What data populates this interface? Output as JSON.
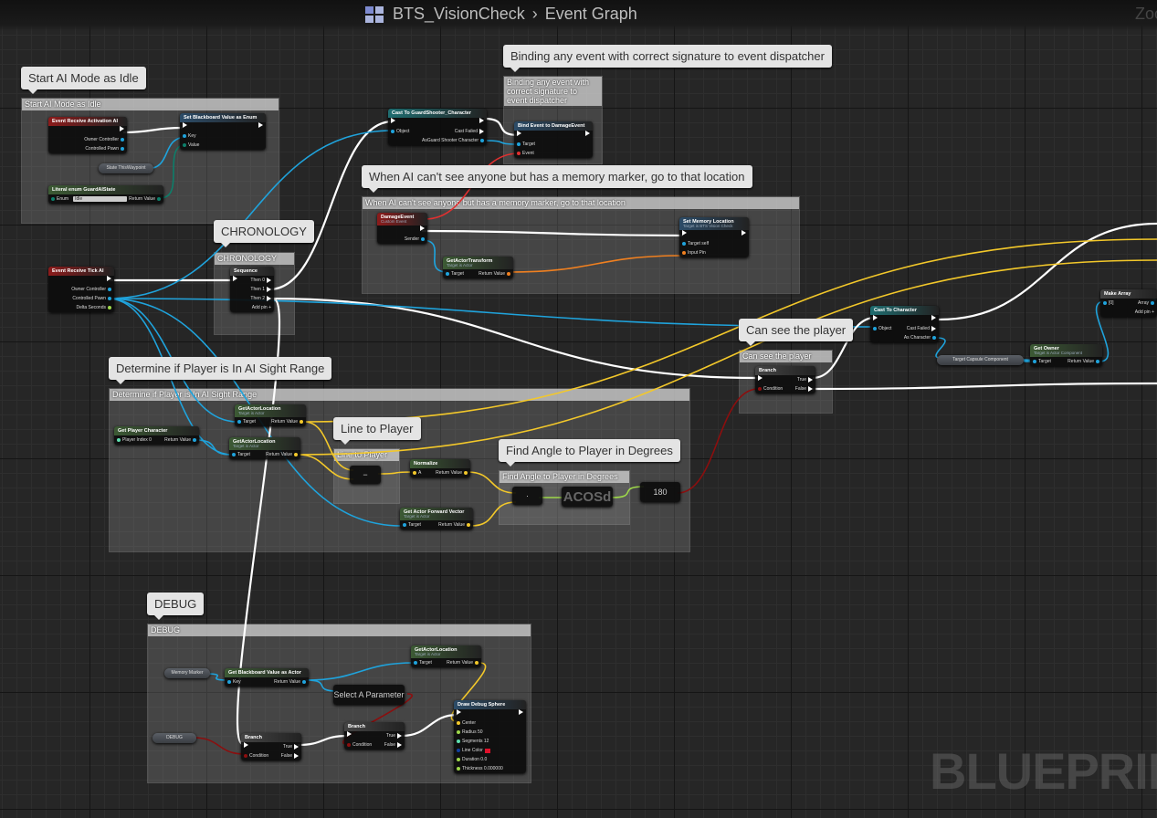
{
  "header": {
    "blueprint": "BTS_VisionCheck",
    "separator": "›",
    "graph": "Event Graph",
    "zoom_label": "Zoom"
  },
  "watermark": "BLUEPRINT",
  "pin_colors": {
    "exec": "#ffffff",
    "object": "#1fa3dc",
    "vector": "#f3c82a",
    "bool": "#8c0e0e",
    "float": "#9ed84a",
    "byte": "#0d7e6a",
    "int": "#5ee0b0",
    "struct": "#f08020",
    "delegate": "#e03030",
    "color": "#1040a0",
    "name": "#c870e0"
  },
  "header_colors": {
    "event": "#8c1b1b",
    "func": "#3c5a34",
    "cast": "#1f6d70",
    "call": "#2c4c68",
    "pure": "#444"
  },
  "comments": [
    {
      "id": "c_idle",
      "title": "Start AI Mode as Idle"
    },
    {
      "id": "c_bind",
      "title": "Binding any event with correct signature to event dispatcher"
    },
    {
      "id": "c_memory",
      "title": "When AI can't see anyone but has a memory marker, go to that location"
    },
    {
      "id": "c_chrono",
      "title": "CHRONOLOGY"
    },
    {
      "id": "c_see",
      "title": "Can see the player"
    },
    {
      "id": "c_sight",
      "title": "Determine if Player is In AI Sight Range"
    },
    {
      "id": "c_line",
      "title": "Line to Player"
    },
    {
      "id": "c_angle",
      "title": "Find Angle to Player in Degrees"
    },
    {
      "id": "c_debug",
      "title": "DEBUG"
    }
  ],
  "nodes": [
    {
      "id": "evt_activation",
      "kind": "event",
      "title": "Event Receive Activation AI",
      "in": [],
      "out": [
        {
          "t": "exec"
        },
        {
          "l": "Owner Controller",
          "t": "object"
        },
        {
          "l": "Controlled Pawn",
          "t": "object"
        }
      ]
    },
    {
      "id": "set_bb_enum",
      "kind": "call",
      "title": "Set Blackboard Value as Enum",
      "in": [
        {
          "t": "exec"
        },
        {
          "l": "Key",
          "t": "object"
        },
        {
          "l": "Value",
          "t": "byte"
        }
      ],
      "out": [
        {
          "t": "exec"
        }
      ]
    },
    {
      "id": "state_var",
      "kind": "var",
      "title": "State ThisWaypoint"
    },
    {
      "id": "literal_enum",
      "kind": "func",
      "title": "Literal enum GuardAIState",
      "in": [
        {
          "l": "Enum",
          "t": "byte",
          "sel": "Idle"
        }
      ],
      "out": [
        {
          "l": "Return Value",
          "t": "byte"
        }
      ]
    },
    {
      "id": "evt_tick",
      "kind": "event",
      "title": "Event Receive Tick AI",
      "in": [],
      "out": [
        {
          "t": "exec"
        },
        {
          "l": "Owner Controller",
          "t": "object"
        },
        {
          "l": "Controlled Pawn",
          "t": "object"
        },
        {
          "l": "Delta Seconds",
          "t": "float"
        }
      ]
    },
    {
      "id": "sequence",
      "kind": "pure",
      "title": "Sequence",
      "in": [
        {
          "t": "exec"
        }
      ],
      "out": [
        {
          "l": "Then 0",
          "t": "exec"
        },
        {
          "l": "Then 1",
          "t": "exec"
        },
        {
          "l": "Then 2",
          "t": "exec"
        },
        {
          "l": "Add pin +",
          "t": "none"
        }
      ]
    },
    {
      "id": "cast_guard",
      "kind": "cast",
      "title": "Cast To GuardShooter_Character",
      "in": [
        {
          "t": "exec"
        },
        {
          "l": "Object",
          "t": "object"
        }
      ],
      "out": [
        {
          "t": "exec"
        },
        {
          "l": "Cast Failed",
          "t": "exec"
        },
        {
          "l": "AsGuard Shooter Character",
          "t": "object"
        }
      ]
    },
    {
      "id": "bind_event",
      "kind": "call",
      "title": "Bind Event to DamageEvent",
      "in": [
        {
          "t": "exec"
        },
        {
          "l": "Target",
          "t": "object"
        },
        {
          "l": "Event",
          "t": "delegate"
        }
      ],
      "out": [
        {
          "t": "exec"
        }
      ]
    },
    {
      "id": "damage_event",
      "kind": "event",
      "title": "DamageEvent",
      "sub": "Custom Event",
      "in": [],
      "out": [
        {
          "t": "exec"
        },
        {
          "l": "Sender",
          "t": "object"
        }
      ]
    },
    {
      "id": "get_transform",
      "kind": "func",
      "title": "GetActorTransform",
      "sub": "Target is Actor",
      "in": [
        {
          "l": "Target",
          "t": "object"
        }
      ],
      "out": [
        {
          "l": "Return Value",
          "t": "struct"
        }
      ]
    },
    {
      "id": "set_memory",
      "kind": "call",
      "title": "Set Memory Location",
      "sub": "Target is BTS Vision Check",
      "in": [
        {
          "t": "exec"
        },
        {
          "l": "Target  self",
          "t": "object"
        },
        {
          "l": "Input Pin",
          "t": "struct"
        }
      ],
      "out": [
        {
          "t": "exec"
        }
      ]
    },
    {
      "id": "branch_see",
      "kind": "pure",
      "title": "Branch",
      "in": [
        {
          "t": "exec"
        },
        {
          "l": "Condition",
          "t": "bool"
        }
      ],
      "out": [
        {
          "l": "True",
          "t": "exec"
        },
        {
          "l": "False",
          "t": "exec"
        }
      ]
    },
    {
      "id": "cast_char",
      "kind": "cast",
      "title": "Cast To Character",
      "in": [
        {
          "t": "exec"
        },
        {
          "l": "Object",
          "t": "object"
        }
      ],
      "out": [
        {
          "t": "exec"
        },
        {
          "l": "Cast Failed",
          "t": "exec"
        },
        {
          "l": "As Character",
          "t": "object"
        }
      ]
    },
    {
      "id": "capsule",
      "kind": "var",
      "title": "Target    Capsule Component"
    },
    {
      "id": "get_owner",
      "kind": "func",
      "title": "Get Owner",
      "sub": "Target is Actor Component",
      "in": [
        {
          "l": "Target",
          "t": "object"
        }
      ],
      "out": [
        {
          "l": "Return Value",
          "t": "object"
        }
      ]
    },
    {
      "id": "make_array",
      "kind": "pure",
      "title": "Make Array",
      "in": [
        {
          "l": "[0]",
          "t": "object"
        }
      ],
      "out": [
        {
          "l": "Array",
          "t": "object"
        },
        {
          "l": "Add pin +",
          "t": "none"
        }
      ]
    },
    {
      "id": "get_player",
      "kind": "func",
      "title": "Get Player Character",
      "in": [
        {
          "l": "Player Index  0",
          "t": "int"
        }
      ],
      "out": [
        {
          "l": "Return Value",
          "t": "object"
        }
      ]
    },
    {
      "id": "gal1",
      "kind": "func",
      "title": "GetActorLocation",
      "sub": "Target is Actor",
      "in": [
        {
          "l": "Target",
          "t": "object"
        }
      ],
      "out": [
        {
          "l": "Return Value",
          "t": "vector"
        }
      ]
    },
    {
      "id": "gal2",
      "kind": "func",
      "title": "GetActorLocation",
      "sub": "Target is Actor",
      "in": [
        {
          "l": "Target",
          "t": "object"
        }
      ],
      "out": [
        {
          "l": "Return Value",
          "t": "vector"
        }
      ]
    },
    {
      "id": "subtract",
      "kind": "op",
      "title": "−"
    },
    {
      "id": "normalize",
      "kind": "func",
      "title": "Normalize",
      "in": [
        {
          "l": "A",
          "t": "vector"
        }
      ],
      "out": [
        {
          "l": "Return Value",
          "t": "vector"
        }
      ]
    },
    {
      "id": "fwd_vector",
      "kind": "func",
      "title": "Get Actor Forward Vector",
      "sub": "Target is Actor",
      "in": [
        {
          "l": "Target",
          "t": "object"
        }
      ],
      "out": [
        {
          "l": "Return Value",
          "t": "vector"
        }
      ]
    },
    {
      "id": "dot",
      "kind": "op",
      "title": "·"
    },
    {
      "id": "acos",
      "kind": "op",
      "title": "ACOSd"
    },
    {
      "id": "compare",
      "kind": "op",
      "title": "180"
    },
    {
      "id": "memory_marker",
      "kind": "var",
      "title": "Memory Marker"
    },
    {
      "id": "get_bb_actor",
      "kind": "func",
      "title": "Get Blackboard Value as Actor",
      "in": [
        {
          "l": "Key",
          "t": "object"
        }
      ],
      "out": [
        {
          "l": "Return Value",
          "t": "object"
        }
      ]
    },
    {
      "id": "gal3",
      "kind": "func",
      "title": "GetActorLocation",
      "sub": "Target is Actor",
      "in": [
        {
          "l": "Target",
          "t": "object"
        }
      ],
      "out": [
        {
          "l": "Return Value",
          "t": "vector"
        }
      ]
    },
    {
      "id": "is_valid",
      "kind": "op",
      "title": "Select A Parameter"
    },
    {
      "id": "debug_var",
      "kind": "var",
      "title": "DEBUG"
    },
    {
      "id": "branch_dbg1",
      "kind": "pure",
      "title": "Branch",
      "in": [
        {
          "t": "exec"
        },
        {
          "l": "Condition",
          "t": "bool"
        }
      ],
      "out": [
        {
          "l": "True",
          "t": "exec"
        },
        {
          "l": "False",
          "t": "exec"
        }
      ]
    },
    {
      "id": "branch_dbg2",
      "kind": "pure",
      "title": "Branch",
      "in": [
        {
          "t": "exec"
        },
        {
          "l": "Condition",
          "t": "bool"
        }
      ],
      "out": [
        {
          "l": "True",
          "t": "exec"
        },
        {
          "l": "False",
          "t": "exec"
        }
      ]
    },
    {
      "id": "draw_sphere",
      "kind": "call",
      "title": "Draw Debug Sphere",
      "in": [
        {
          "t": "exec"
        },
        {
          "l": "Center",
          "t": "vector"
        },
        {
          "l": "Radius  50",
          "t": "float"
        },
        {
          "l": "Segments  12",
          "t": "int"
        },
        {
          "l": "Line Color",
          "t": "color",
          "swatch": "#e0102a"
        },
        {
          "l": "Duration  0.0",
          "t": "float"
        },
        {
          "l": "Thickness  0.000000",
          "t": "float"
        }
      ],
      "out": [
        {
          "t": "exec"
        }
      ]
    }
  ]
}
